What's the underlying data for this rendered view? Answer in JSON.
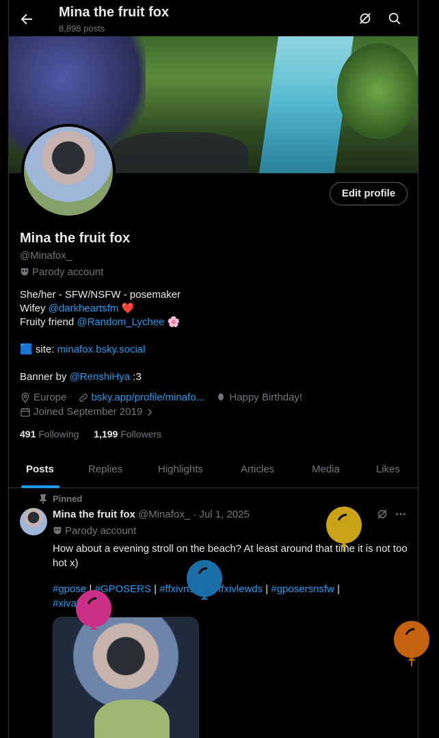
{
  "header": {
    "title": "Mina the fruit fox",
    "post_count": "8,898 posts"
  },
  "profile": {
    "name": "Mina the fruit fox",
    "handle": "@Minafox_",
    "parody_label": "Parody account",
    "edit_button": "Edit profile",
    "bio": {
      "line1": "She/her - SFW/NSFW - posemaker",
      "wifey_prefix": "Wifey ",
      "wifey_link": "@darkheartsfm",
      "wifey_emoji": "❤️",
      "friend_prefix": "Fruity friend ",
      "friend_link": "@Random_Lychee",
      "friend_emoji": "🌸",
      "site_emoji": "🟦",
      "site_prefix": " site: ",
      "site_link": "minafox.bsky.social",
      "banner_prefix": "Banner by ",
      "banner_link": "@RenshiHya",
      "banner_suffix": " :3"
    },
    "location": "Europe",
    "website": "bsky.app/profile/minafo...",
    "birthday": "Happy Birthday!",
    "joined": "Joined September 2019",
    "following_count": "491",
    "following_label": "Following",
    "followers_count": "1,199",
    "followers_label": "Followers"
  },
  "tabs": [
    "Posts",
    "Replies",
    "Highlights",
    "Articles",
    "Media",
    "Likes"
  ],
  "post": {
    "pinned_label": "Pinned",
    "author": "Mina the fruit fox",
    "handle": "@Minafox_",
    "separator": " · ",
    "date": "Jul 1, 2025",
    "parody_label": "Parody account",
    "text": "How about a evening stroll on the beach? At least around that time it is not too hot x)",
    "tags_line1": [
      {
        "tag": "#gpose",
        "sep": " | "
      },
      {
        "tag": "#GPOSERS",
        "sep": "  | "
      },
      {
        "tag": "#ffxivnsfw",
        "sep": " | "
      },
      {
        "tag": "#ffxivlewds",
        "sep": " | "
      },
      {
        "tag": "#gposersnsfw",
        "sep": " |"
      }
    ],
    "tags_line2": "#xivafterdark"
  },
  "colors": {
    "accent": "#1d9bf0",
    "balloon_yellow": "#c9a216",
    "balloon_blue": "#1a6fa8",
    "balloon_pink": "#cc2f86",
    "balloon_orange": "#c4620f"
  },
  "icons": [
    "back-arrow-icon",
    "grok-icon",
    "search-icon",
    "parody-mask-icon",
    "location-icon",
    "link-icon",
    "balloon-icon",
    "calendar-icon",
    "chevron-right-icon",
    "pin-icon",
    "more-icon"
  ]
}
